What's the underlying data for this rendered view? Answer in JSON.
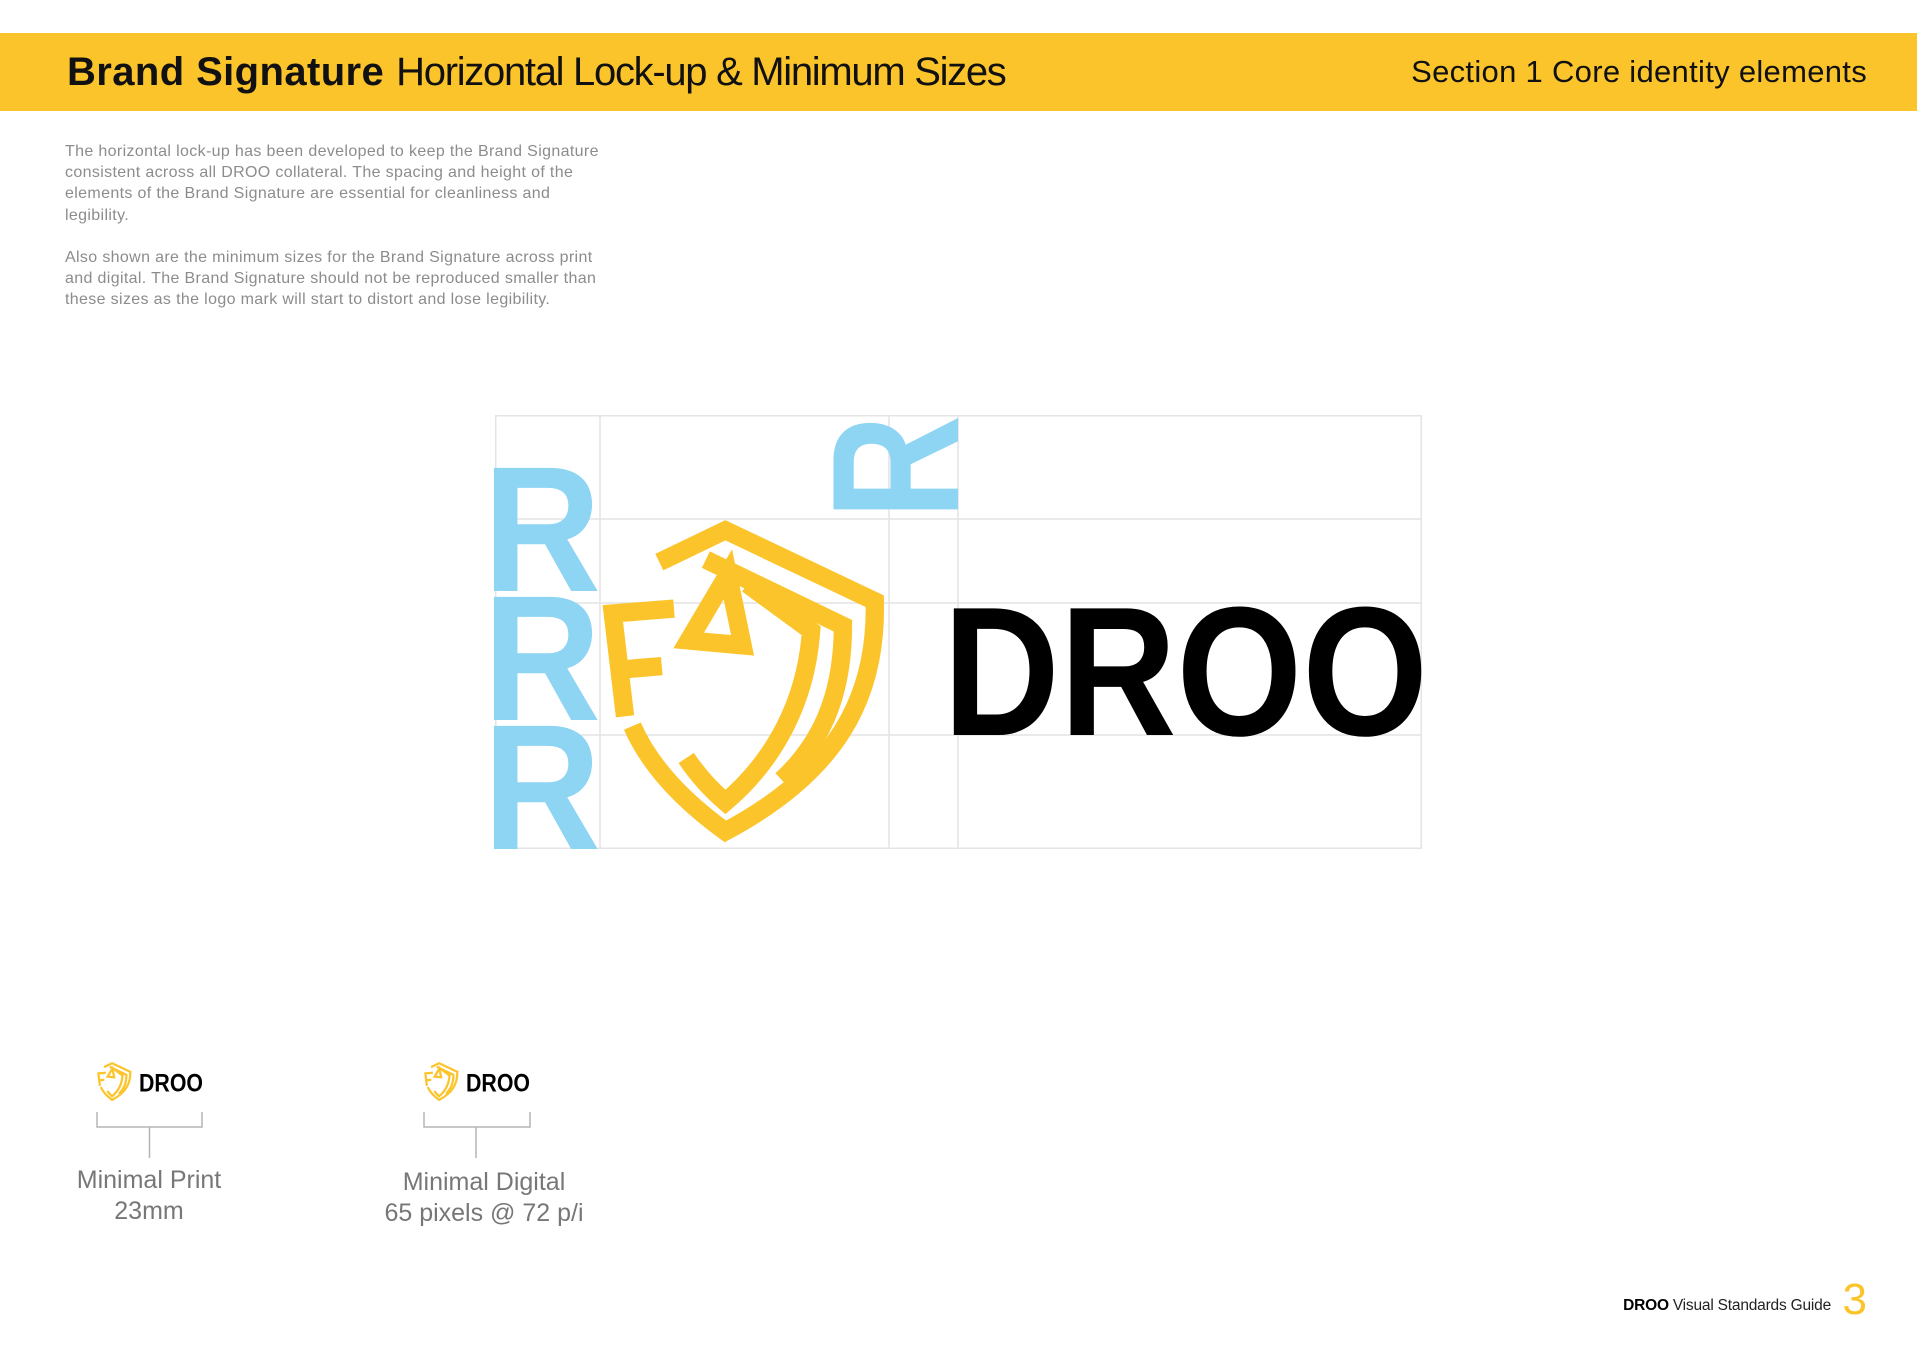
{
  "header": {
    "title_bold": "Brand Signature",
    "title_light": "Horizontal Lock-up & Minimum Sizes",
    "section": "Section 1 Core identity elements"
  },
  "intro": {
    "paragraphs": [
      {
        "lines": [
          "The horizontal lock-up has been developed to keep the Brand Signature",
          "consistent across all DROO collateral. The spacing and height of the",
          "elements of the Brand Signature are essential for cleanliness and",
          "legibility."
        ]
      },
      {
        "lines": [
          "Also shown are the minimum sizes for the Brand Signature across print",
          "and digital. The Brand Signature should not be reproduced smaller than",
          "these sizes as the logo mark will start to distort and lose legibility."
        ]
      }
    ]
  },
  "lockup": {
    "wordmark": "DROO",
    "spacing_unit_glyph": "R",
    "logomark_icon": "shield-logo-icon"
  },
  "minimum_sizes": [
    {
      "wordmark": "DROO",
      "label": "Minimal Print",
      "value": "23mm"
    },
    {
      "wordmark": "DROO",
      "label": "Minimal Digital",
      "value": "65 pixels @ 72 p/i"
    }
  ],
  "footer": {
    "brand": "DROO",
    "guide_title": "Visual Standards Guide",
    "page_number": "3"
  },
  "colors": {
    "brand_yellow": "#fcc42b",
    "guide_blue": "#8ed4f3",
    "wordmark_black": "#000000",
    "body_grey": "#8c8c8c"
  }
}
